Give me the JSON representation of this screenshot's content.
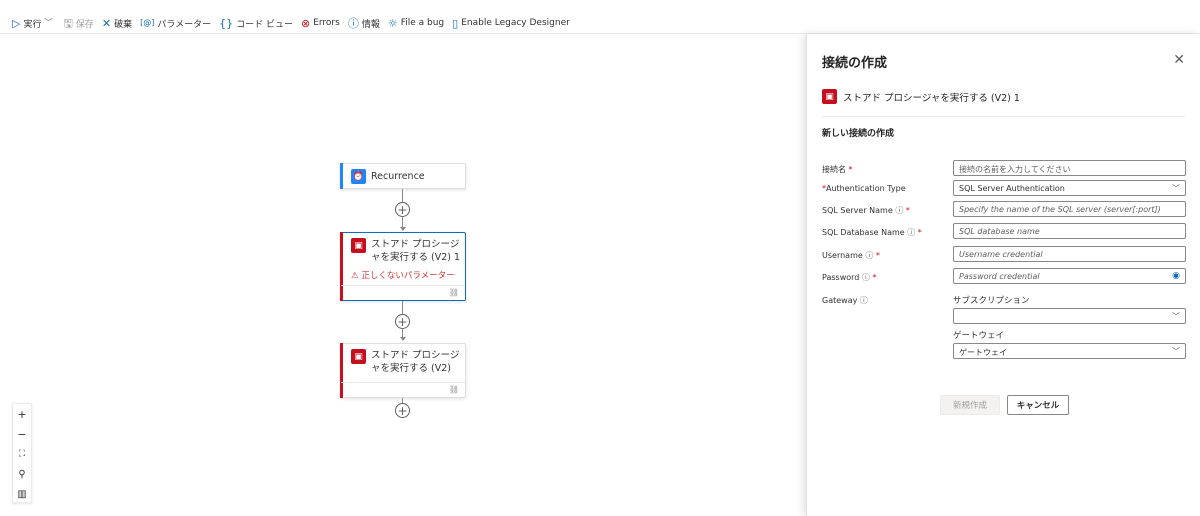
{
  "toolbar": {
    "run": "実行",
    "save": "保存",
    "discard": "破棄",
    "parameters": "パラメーター",
    "code_view": "コード ビュー",
    "errors": "Errors",
    "info": "情報",
    "file_bug": "File a bug",
    "legacy": "Enable Legacy Designer"
  },
  "canvas": {
    "recurrence": {
      "title": "Recurrence",
      "icon": "alarm-clock-icon",
      "color": "#1f85ff"
    },
    "action1": {
      "title_line1": "ストアド プロシージ",
      "title_line2": "ャを実行する (V2) 1",
      "error": "正しくないパラメーター",
      "color": "#c50f1f"
    },
    "action2": {
      "title_line1": "ストアド プロシージ",
      "title_line2": "ャを実行する (V2)",
      "color": "#c50f1f"
    }
  },
  "zoom": {
    "zoom_in": "+",
    "zoom_out": "−"
  },
  "panel": {
    "title": "接続の作成",
    "connector": "ストアド プロシージャを実行する (V2) 1",
    "section": "新しい接続の作成",
    "fields": {
      "conn_name": {
        "label": "接続名",
        "placeholder": "接続の名前を入力してください"
      },
      "auth_type": {
        "label": "Authentication Type",
        "value": "SQL Server Authentication"
      },
      "server": {
        "label": "SQL Server Name",
        "placeholder": "Specify the name of the SQL server (server[:port])"
      },
      "database": {
        "label": "SQL Database Name",
        "placeholder": "SQL database name"
      },
      "username": {
        "label": "Username",
        "placeholder": "Username credential"
      },
      "password": {
        "label": "Password",
        "placeholder": "Password credential"
      },
      "gateway": {
        "label": "Gateway"
      }
    },
    "subscription_label": "サブスクリプション",
    "subscription_value": "",
    "gateway_label": "ゲートウェイ",
    "gateway_value": "ゲートウェイ",
    "create_button": "新規作成",
    "cancel_button": "キャンセル"
  }
}
